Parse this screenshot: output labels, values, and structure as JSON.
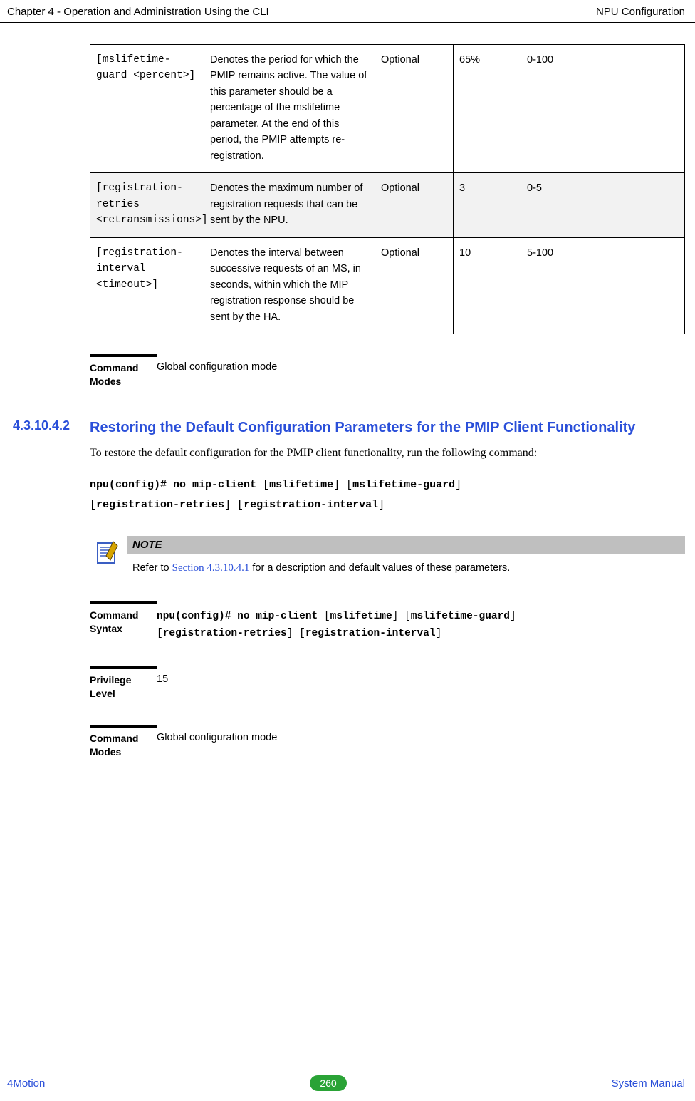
{
  "header": {
    "left": "Chapter 4 - Operation and Administration Using the CLI",
    "right": "NPU Configuration"
  },
  "params": {
    "cols": [
      "param",
      "desc",
      "presence",
      "default",
      "range"
    ],
    "rows": [
      {
        "param": "[mslifetime-guard <percent>]",
        "desc": "Denotes the period for which the PMIP remains active. The value of this parameter should be a percentage of the mslifetime parameter. At the end of this period, the PMIP attempts re-registration.",
        "presence": "Optional",
        "default": "65%",
        "range": "0-100"
      },
      {
        "param": "[registration-retries <retransmissions>]",
        "desc": "Denotes the maximum number of registration requests that can be sent by the NPU.",
        "presence": "Optional",
        "default": "3",
        "range": "0-5"
      },
      {
        "param": "[registration-interval <timeout>]",
        "desc": "Denotes the interval between successive requests of an MS, in seconds, within which the MIP registration response should be sent by the HA.",
        "presence": "Optional",
        "default": "10",
        "range": "5-100"
      }
    ]
  },
  "command_modes": {
    "label": "Command Modes",
    "value": "Global configuration mode"
  },
  "section": {
    "num": "4.3.10.4.2",
    "title": "Restoring the Default Configuration Parameters for the PMIP Client Functionality",
    "body": "To restore the default configuration for the PMIP client functionality, run the following command:",
    "cmd_full": "npu(config)# no mip-client [mslifetime] [mslifetime-guard] [registration-retries] [registration-interval]",
    "cmd_line1_bold_a": "npu(config)# no mip-client",
    "cmd_line1_plain_a": " [",
    "cmd_line1_bold_b": "mslifetime",
    "cmd_line1_plain_b": "] [",
    "cmd_line1_bold_c": "mslifetime-guard",
    "cmd_line1_plain_c": "]",
    "cmd_line2_plain_a": "[",
    "cmd_line2_bold_a": "registration-retries",
    "cmd_line2_plain_b": "] [",
    "cmd_line2_bold_b": "registration-interval",
    "cmd_line2_plain_c": "]"
  },
  "note": {
    "header": "NOTE",
    "text_pre": "Refer to ",
    "link": "Section 4.3.10.4.1",
    "text_post": " for a description and default values of these parameters."
  },
  "kv": {
    "syntax_label": "Command Syntax",
    "priv_label": "Privilege Level",
    "priv_value": "15",
    "modes_label": "Command Modes",
    "modes_value": "Global configuration mode"
  },
  "footer": {
    "product": "4Motion",
    "page": "260",
    "manual": "System Manual"
  }
}
